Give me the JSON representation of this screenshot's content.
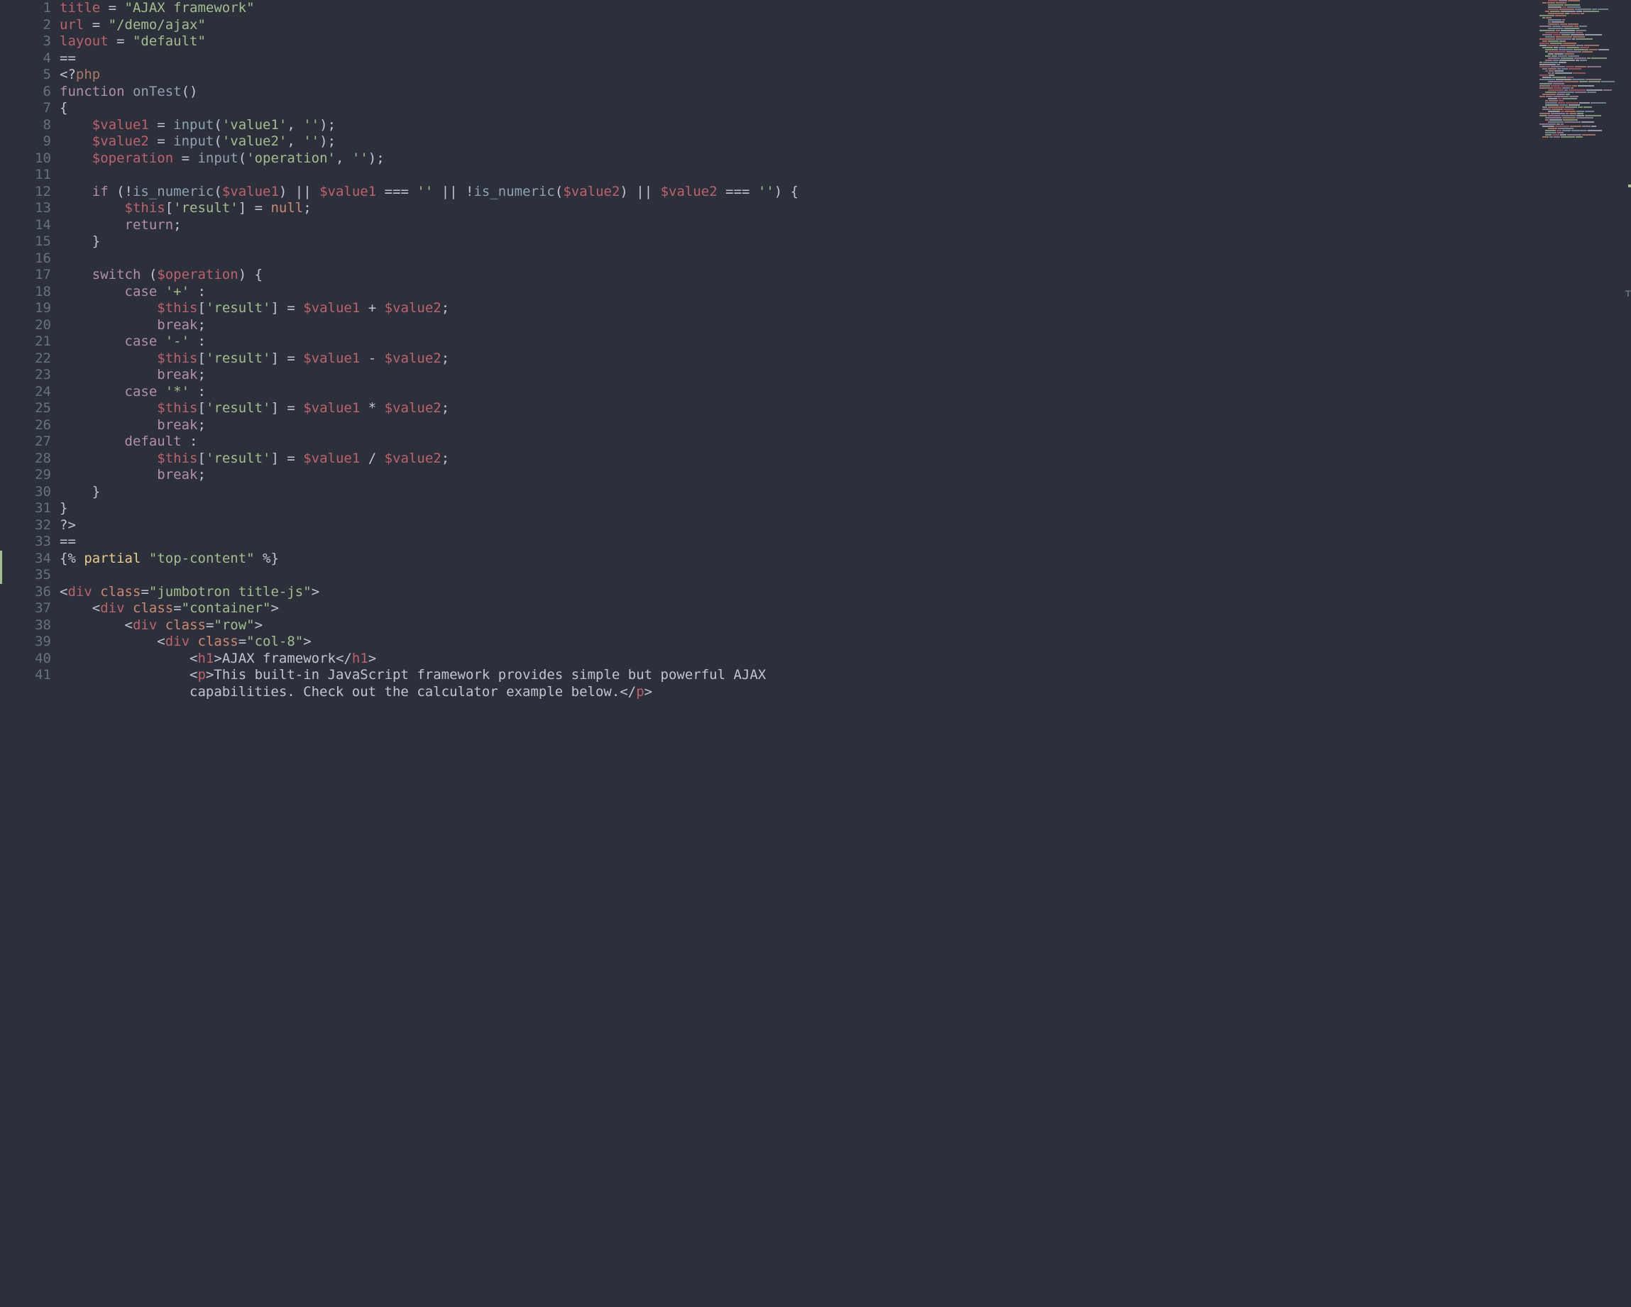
{
  "line_numbers": [
    "1",
    "2",
    "3",
    "4",
    "5",
    "6",
    "7",
    "8",
    "9",
    "10",
    "11",
    "12",
    "13",
    "14",
    "15",
    "16",
    "17",
    "18",
    "19",
    "20",
    "21",
    "22",
    "23",
    "24",
    "25",
    "26",
    "27",
    "28",
    "29",
    "30",
    "31",
    "32",
    "33",
    "34",
    "35",
    "36",
    "37",
    "38",
    "39",
    "40",
    "41"
  ],
  "modified_lines": [
    34,
    35
  ],
  "code": {
    "l1": {
      "key": "title",
      "eq": " = ",
      "val": "\"AJAX framework\""
    },
    "l2": {
      "key": "url",
      "eq": " = ",
      "val": "\"/demo/ajax\""
    },
    "l3": {
      "key": "layout",
      "eq": " = ",
      "val": "\"default\""
    },
    "l4": {
      "sep": "=="
    },
    "l5": {
      "open": "<?",
      "php": "php"
    },
    "l6": {
      "kw": "function",
      "sp": " ",
      "fn": "onTest",
      "paren": "()"
    },
    "l7": {
      "brace": "{"
    },
    "l8": {
      "indent": "    ",
      "var": "$value1",
      "rest": " = ",
      "fn": "input",
      "p1": "(",
      "s1": "'value1'",
      "c1": ", ",
      "s2": "''",
      "p2": ");"
    },
    "l9": {
      "indent": "    ",
      "var": "$value2",
      "rest": " = ",
      "fn": "input",
      "p1": "(",
      "s1": "'value2'",
      "c1": ", ",
      "s2": "''",
      "p2": ");"
    },
    "l10": {
      "indent": "    ",
      "var": "$operation",
      "rest": " = ",
      "fn": "input",
      "p1": "(",
      "s1": "'operation'",
      "c1": ", ",
      "s2": "''",
      "p2": ");"
    },
    "l11": {
      "blank": ""
    },
    "l12": {
      "indent": "    ",
      "kw": "if",
      "sp": " (!",
      "fn1": "is_numeric",
      "p1": "(",
      "v1": "$value1",
      "p2": ") || ",
      "v2": "$value1",
      "eq": " === ",
      "s1": "''",
      "or": " || !",
      "fn2": "is_numeric",
      "p3": "(",
      "v3": "$value2",
      "p4": ") || ",
      "v4": "$value2",
      "eq2": " === ",
      "s2": "''",
      "end": ") {"
    },
    "l13": {
      "indent": "        ",
      "this": "$this",
      "br": "[",
      "s": "'result'",
      "br2": "]",
      "eq": " = ",
      "null": "null",
      "end": ";"
    },
    "l14": {
      "indent": "        ",
      "kw": "return",
      "end": ";"
    },
    "l15": {
      "indent": "    ",
      "brace": "}"
    },
    "l16": {
      "blank": ""
    },
    "l17": {
      "indent": "    ",
      "kw": "switch",
      "sp": " (",
      "var": "$operation",
      "end": ") {"
    },
    "l18": {
      "indent": "        ",
      "kw": "case",
      "sp": " ",
      "s": "'+'",
      "col": " :"
    },
    "l19": {
      "indent": "            ",
      "this": "$this",
      "br": "[",
      "s": "'result'",
      "br2": "]",
      "eq": " = ",
      "v1": "$value1",
      "op": " + ",
      "v2": "$value2",
      "end": ";"
    },
    "l20": {
      "indent": "            ",
      "kw": "break",
      "end": ";"
    },
    "l21": {
      "indent": "        ",
      "kw": "case",
      "sp": " ",
      "s": "'-'",
      "col": " :"
    },
    "l22": {
      "indent": "            ",
      "this": "$this",
      "br": "[",
      "s": "'result'",
      "br2": "]",
      "eq": " = ",
      "v1": "$value1",
      "op": " - ",
      "v2": "$value2",
      "end": ";"
    },
    "l23": {
      "indent": "            ",
      "kw": "break",
      "end": ";"
    },
    "l24": {
      "indent": "        ",
      "kw": "case",
      "sp": " ",
      "s": "'*'",
      "col": " :"
    },
    "l25": {
      "indent": "            ",
      "this": "$this",
      "br": "[",
      "s": "'result'",
      "br2": "]",
      "eq": " = ",
      "v1": "$value1",
      "op": " * ",
      "v2": "$value2",
      "end": ";"
    },
    "l26": {
      "indent": "            ",
      "kw": "break",
      "end": ";"
    },
    "l27": {
      "indent": "        ",
      "kw": "default",
      "col": " :"
    },
    "l28": {
      "indent": "            ",
      "this": "$this",
      "br": "[",
      "s": "'result'",
      "br2": "]",
      "eq": " = ",
      "v1": "$value1",
      "op": " / ",
      "v2": "$value2",
      "end": ";"
    },
    "l29": {
      "indent": "            ",
      "kw": "break",
      "end": ";"
    },
    "l30": {
      "indent": "    ",
      "brace": "}"
    },
    "l31": {
      "brace": "}"
    },
    "l32": {
      "php": "?>"
    },
    "l33": {
      "sep": "=="
    },
    "l34": {
      "open": "{%",
      "sp": " ",
      "kw": "partial",
      "sp2": " ",
      "s": "\"top-content\"",
      "sp3": " ",
      "close": "%}"
    },
    "l35": {
      "blank": ""
    },
    "l36": {
      "lt": "<",
      "tag": "div",
      "sp": " ",
      "attr": "class",
      "eq": "=",
      "val": "\"jumbotron title-js\"",
      "gt": ">"
    },
    "l37": {
      "indent": "    ",
      "lt": "<",
      "tag": "div",
      "sp": " ",
      "attr": "class",
      "eq": "=",
      "val": "\"container\"",
      "gt": ">"
    },
    "l38": {
      "indent": "        ",
      "lt": "<",
      "tag": "div",
      "sp": " ",
      "attr": "class",
      "eq": "=",
      "val": "\"row\"",
      "gt": ">"
    },
    "l39": {
      "indent": "            ",
      "lt": "<",
      "tag": "div",
      "sp": " ",
      "attr": "class",
      "eq": "=",
      "val": "\"col-8\"",
      "gt": ">"
    },
    "l40": {
      "indent": "                ",
      "lt": "<",
      "tag": "h1",
      "gt": ">",
      "txt": "AJAX framework",
      "lt2": "</",
      "tag2": "h1",
      "gt2": ">"
    },
    "l41": {
      "indent": "                ",
      "lt": "<",
      "tag": "p",
      "gt": ">",
      "txt1": "This built-in JavaScript framework provides simple but powerful AJAX ",
      "txt2": "capabilities. Check out the calculator example below.",
      "lt2": "</",
      "tag2": "p",
      "gt2": ">"
    }
  },
  "minimap_hint": "syntax-colored overview of full file"
}
